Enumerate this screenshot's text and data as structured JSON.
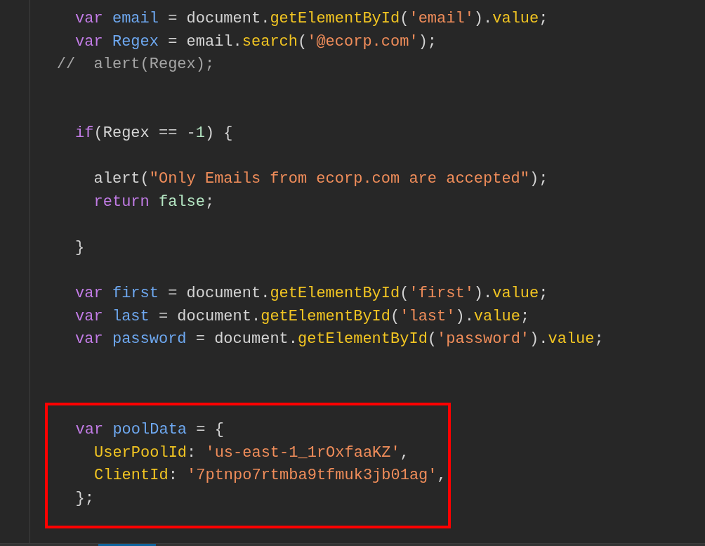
{
  "lines": [
    {
      "kind": "code",
      "tokens": [
        {
          "kind": "keyword",
          "text": "        var"
        },
        {
          "kind": "variable",
          "text": " email"
        },
        {
          "kind": "plain",
          "text": " = document."
        },
        {
          "kind": "function",
          "text": "getElementById"
        },
        {
          "kind": "plain",
          "text": "("
        },
        {
          "kind": "string",
          "text": "'email'"
        },
        {
          "kind": "plain",
          "text": ")."
        },
        {
          "kind": "function",
          "text": "value"
        },
        {
          "kind": "plain",
          "text": ";"
        }
      ]
    },
    {
      "kind": "code",
      "tokens": [
        {
          "kind": "keyword",
          "text": "        var"
        },
        {
          "kind": "variable",
          "text": " Regex"
        },
        {
          "kind": "plain",
          "text": " = email."
        },
        {
          "kind": "function",
          "text": "search"
        },
        {
          "kind": "plain",
          "text": "("
        },
        {
          "kind": "string",
          "text": "'@ecorp.com'"
        },
        {
          "kind": "plain",
          "text": ");"
        }
      ]
    },
    {
      "kind": "code",
      "tokens": [
        {
          "kind": "comment",
          "text": "      //  alert(Regex);"
        }
      ]
    },
    {
      "kind": "blank"
    },
    {
      "kind": "blank"
    },
    {
      "kind": "code",
      "tokens": [
        {
          "kind": "keyword",
          "text": "        if"
        },
        {
          "kind": "plain",
          "text": "(Regex == -"
        },
        {
          "kind": "number",
          "text": "1"
        },
        {
          "kind": "plain",
          "text": ") {"
        }
      ]
    },
    {
      "kind": "blank"
    },
    {
      "kind": "code",
      "tokens": [
        {
          "kind": "plain",
          "text": "          alert("
        },
        {
          "kind": "string",
          "text": "\"Only Emails from ecorp.com are accepted\""
        },
        {
          "kind": "plain",
          "text": ");"
        }
      ]
    },
    {
      "kind": "code",
      "tokens": [
        {
          "kind": "keyword",
          "text": "          return"
        },
        {
          "kind": "number",
          "text": " false"
        },
        {
          "kind": "plain",
          "text": ";"
        }
      ]
    },
    {
      "kind": "blank"
    },
    {
      "kind": "code",
      "tokens": [
        {
          "kind": "plain",
          "text": "        }"
        }
      ]
    },
    {
      "kind": "blank"
    },
    {
      "kind": "code",
      "tokens": [
        {
          "kind": "keyword",
          "text": "        var"
        },
        {
          "kind": "variable",
          "text": " first"
        },
        {
          "kind": "plain",
          "text": " = document."
        },
        {
          "kind": "function",
          "text": "getElementById"
        },
        {
          "kind": "plain",
          "text": "("
        },
        {
          "kind": "string",
          "text": "'first'"
        },
        {
          "kind": "plain",
          "text": ")."
        },
        {
          "kind": "function",
          "text": "value"
        },
        {
          "kind": "plain",
          "text": ";"
        }
      ]
    },
    {
      "kind": "code",
      "tokens": [
        {
          "kind": "keyword",
          "text": "        var"
        },
        {
          "kind": "variable",
          "text": " last"
        },
        {
          "kind": "plain",
          "text": " = document."
        },
        {
          "kind": "function",
          "text": "getElementById"
        },
        {
          "kind": "plain",
          "text": "("
        },
        {
          "kind": "string",
          "text": "'last'"
        },
        {
          "kind": "plain",
          "text": ")."
        },
        {
          "kind": "function",
          "text": "value"
        },
        {
          "kind": "plain",
          "text": ";"
        }
      ]
    },
    {
      "kind": "code",
      "tokens": [
        {
          "kind": "keyword",
          "text": "        var"
        },
        {
          "kind": "variable",
          "text": " password"
        },
        {
          "kind": "plain",
          "text": " = document."
        },
        {
          "kind": "function",
          "text": "getElementById"
        },
        {
          "kind": "plain",
          "text": "("
        },
        {
          "kind": "string",
          "text": "'password'"
        },
        {
          "kind": "plain",
          "text": ")."
        },
        {
          "kind": "function",
          "text": "value"
        },
        {
          "kind": "plain",
          "text": ";"
        }
      ]
    },
    {
      "kind": "blank"
    },
    {
      "kind": "blank"
    }
  ],
  "highlight": {
    "lines": [
      {
        "kind": "code",
        "tokens": [
          {
            "kind": "keyword",
            "text": "   var"
          },
          {
            "kind": "variable",
            "text": " poolData"
          },
          {
            "kind": "plain",
            "text": " = {"
          }
        ]
      },
      {
        "kind": "code",
        "tokens": [
          {
            "kind": "function",
            "text": "     UserPoolId"
          },
          {
            "kind": "plain",
            "text": ": "
          },
          {
            "kind": "string",
            "text": "'us-east-1_1rOxfaaKZ'"
          },
          {
            "kind": "plain",
            "text": ","
          }
        ]
      },
      {
        "kind": "code",
        "tokens": [
          {
            "kind": "function",
            "text": "     ClientId"
          },
          {
            "kind": "plain",
            "text": ": "
          },
          {
            "kind": "string",
            "text": "'7ptnpo7rtmba9tfmuk3jb01ag'"
          },
          {
            "kind": "plain",
            "text": ","
          }
        ]
      },
      {
        "kind": "code",
        "tokens": [
          {
            "kind": "plain",
            "text": "   };"
          }
        ]
      }
    ]
  }
}
